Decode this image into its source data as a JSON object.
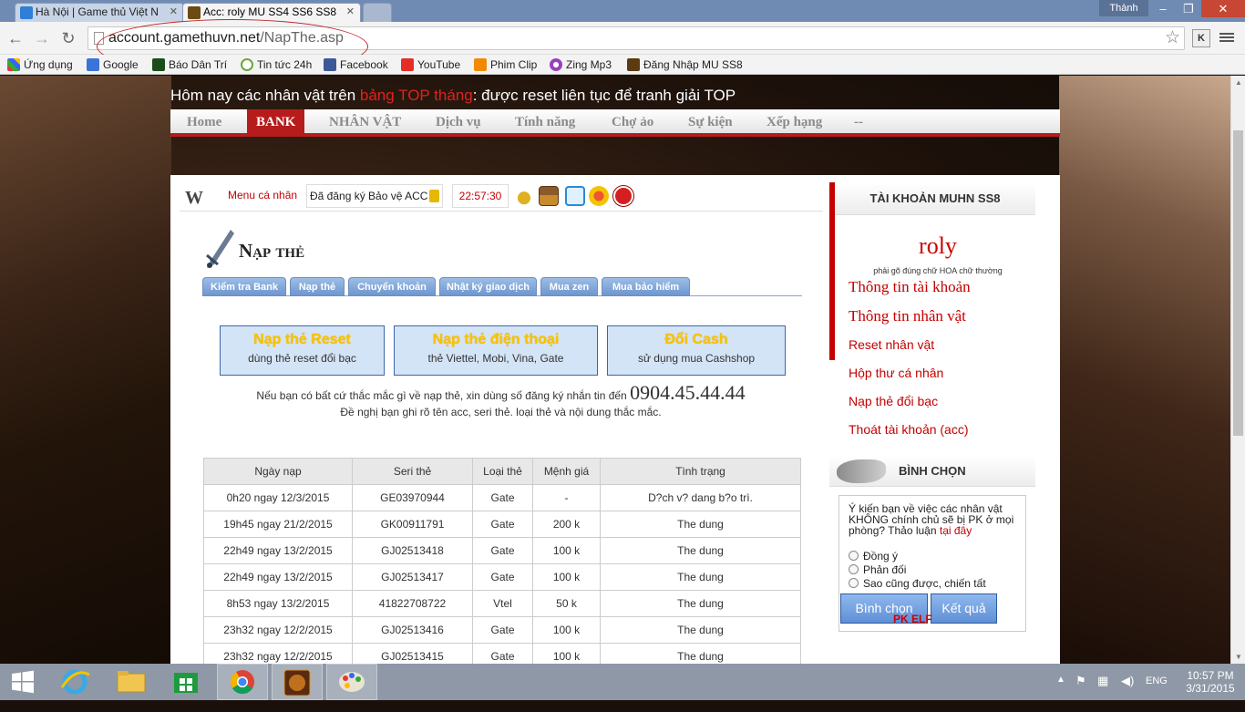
{
  "browser": {
    "tabs": [
      {
        "label": "Hà Nội | Game thủ Việt N",
        "active": false
      },
      {
        "label": "Acc: roly MU SS4 SS6 SS8",
        "active": true
      }
    ],
    "user_chip": "Thành",
    "window_buttons": [
      "minimize-icon",
      "maximize-icon",
      "close-icon"
    ],
    "url_host": "account.gamethuvn.net",
    "url_path": "/NapThe.asp",
    "ext_label": "K",
    "bookmarks": [
      "Ứng dụng",
      "Google",
      "Báo Dân Trí",
      "Tin tức 24h",
      "Facebook",
      "YouTube",
      "Phim Clip",
      "Zing Mp3",
      "Đăng Nhập MU SS8"
    ]
  },
  "marquee": {
    "part1": "Hôm nay các nhân vật trên ",
    "highlight": "bảng TOP tháng",
    "part2": ": được reset liên tục để tranh giải TOP"
  },
  "topnav": [
    "Home",
    "BANK",
    "NHÂN VẬT",
    "Dịch vụ",
    "Tính năng",
    "Chợ ảo",
    "Sự kiện",
    "Xếp hạng",
    "--"
  ],
  "userbar": {
    "logo": "W",
    "menu_label": "Menu cá nhân",
    "protect_text": "Đã đăng ký Bảo vệ ACC",
    "clock": "22:57:30"
  },
  "page_title": "Nạp thẻ",
  "subtabs": [
    "Kiểm tra Bank",
    "Nạp thẻ",
    "Chuyển khoản",
    "Nhật ký giao dịch",
    "Mua zen",
    "Mua bảo hiểm"
  ],
  "cards": [
    {
      "title": "Nạp thẻ Reset",
      "sub": "dùng thẻ reset đổi bạc"
    },
    {
      "title": "Nạp thẻ điện thoại",
      "sub": "thẻ Viettel, Mobi, Vina, Gate"
    },
    {
      "title": "Đổi Cash",
      "sub": "sử dụng mua Cashshop"
    }
  ],
  "contact": {
    "line1": "Nếu bạn có bất cứ thắc mắc gì về nạp thẻ, xin dùng số đăng ký nhắn tin đến ",
    "phone": "0904.45.44.44",
    "line2": "Đề nghị bạn ghi rõ tên acc, seri thẻ. loại thẻ và nội dung thắc mắc."
  },
  "history": {
    "headers": [
      "Ngày nạp",
      "Seri thẻ",
      "Loại thẻ",
      "Mệnh giá",
      "Tình trạng"
    ],
    "rows": [
      [
        "0h20 ngay 12/3/2015",
        "GE03970944",
        "Gate",
        "-",
        "D?ch v? dang b?o trì."
      ],
      [
        "19h45 ngay 21/2/2015",
        "GK00911791",
        "Gate",
        "200 k",
        "The dung"
      ],
      [
        "22h49 ngay 13/2/2015",
        "GJ02513418",
        "Gate",
        "100 k",
        "The dung"
      ],
      [
        "22h49 ngay 13/2/2015",
        "GJ02513417",
        "Gate",
        "100 k",
        "The dung"
      ],
      [
        "8h53 ngay 13/2/2015",
        "41822708722",
        "Vtel",
        "50 k",
        "The dung"
      ],
      [
        "23h32 ngay 12/2/2015",
        "GJ02513416",
        "Gate",
        "100 k",
        "The dung"
      ],
      [
        "23h32 ngay 12/2/2015",
        "GJ02513415",
        "Gate",
        "100 k",
        "The dung"
      ]
    ]
  },
  "sidebar": {
    "header": "TÀI KHOẢN MUHN SS8",
    "username": "roly",
    "hint": "phải gõ đúng chữ HOA chữ thường",
    "links_big": [
      "Thông tin tài khoản",
      "Thông tin nhân vật"
    ],
    "links_small": [
      "Reset nhân vật",
      "Hộp thư cá nhân",
      "Nạp thẻ đổi bạc",
      "Thoát tài khoản (acc)"
    ],
    "vote": {
      "title": "BÌNH CHỌN",
      "question": "Ý kiến bạn về việc các nhân vật KHÔNG chính chủ sẽ bị PK ở mọi phòng? Thảo luận ",
      "question_link": "tại đây",
      "options": [
        "Đồng ý",
        "Phản đối",
        "Sao cũng được, chiến tất"
      ],
      "vote_btn": "Bình chọn",
      "result_btn": "Kết quả"
    },
    "banner_text": "PK    ELF"
  },
  "taskbar": {
    "lang": "ENG",
    "time": "10:57 PM",
    "date": "3/31/2015"
  }
}
